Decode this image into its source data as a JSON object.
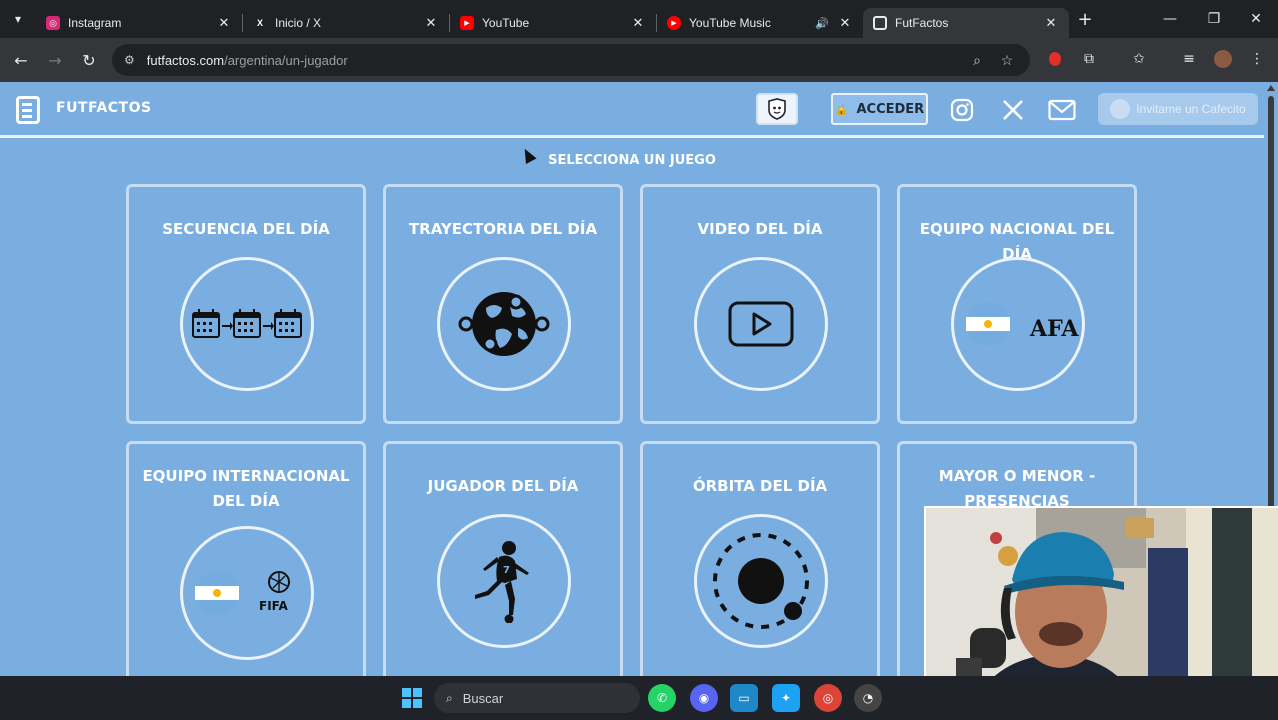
{
  "browser": {
    "tabs": [
      {
        "title": "Instagram",
        "icon": "instagram-icon",
        "color": "#d62976"
      },
      {
        "title": "Inicio / X",
        "icon": "x-icon",
        "color": "#000000"
      },
      {
        "title": "YouTube",
        "icon": "youtube-icon",
        "color": "#ff0000"
      },
      {
        "title": "YouTube Music",
        "icon": "youtube-music-icon",
        "color": "#ff0000"
      },
      {
        "title": "FutFactos",
        "icon": "futfactos-icon",
        "color": "#7aaee0",
        "active": true
      }
    ],
    "address": {
      "host": "futfactos.com",
      "path": "/argentina/un-jugador"
    }
  },
  "site": {
    "brand": "FUTFACTOS",
    "acceder": "ACCEDER",
    "cafecito": "Invitame un Cafecito",
    "section_title": "SELECCIONA UN JUEGO",
    "games": [
      {
        "label": "SECUENCIA DEL DÍA",
        "icon": "calendar-sequence-icon"
      },
      {
        "label": "TRAYECTORIA DEL DÍA",
        "icon": "globe-icon"
      },
      {
        "label": "VIDEO DEL DÍA",
        "icon": "play-icon"
      },
      {
        "label": "EQUIPO NACIONAL DEL DÍA",
        "icon": "argentina-afa-icon",
        "afa": "AFA"
      },
      {
        "label": "EQUIPO INTERNACIONAL DEL DÍA",
        "icon": "argentina-fifa-icon",
        "fifa": "FIFA"
      },
      {
        "label": "JUGADOR DEL DÍA",
        "icon": "player-icon"
      },
      {
        "label": "ÓRBITA DEL DÍA",
        "icon": "orbit-icon"
      },
      {
        "label": "MAYOR O MENOR - PRESENCIAS",
        "icon": "unknown"
      }
    ]
  },
  "taskbar": {
    "search": "Buscar"
  }
}
